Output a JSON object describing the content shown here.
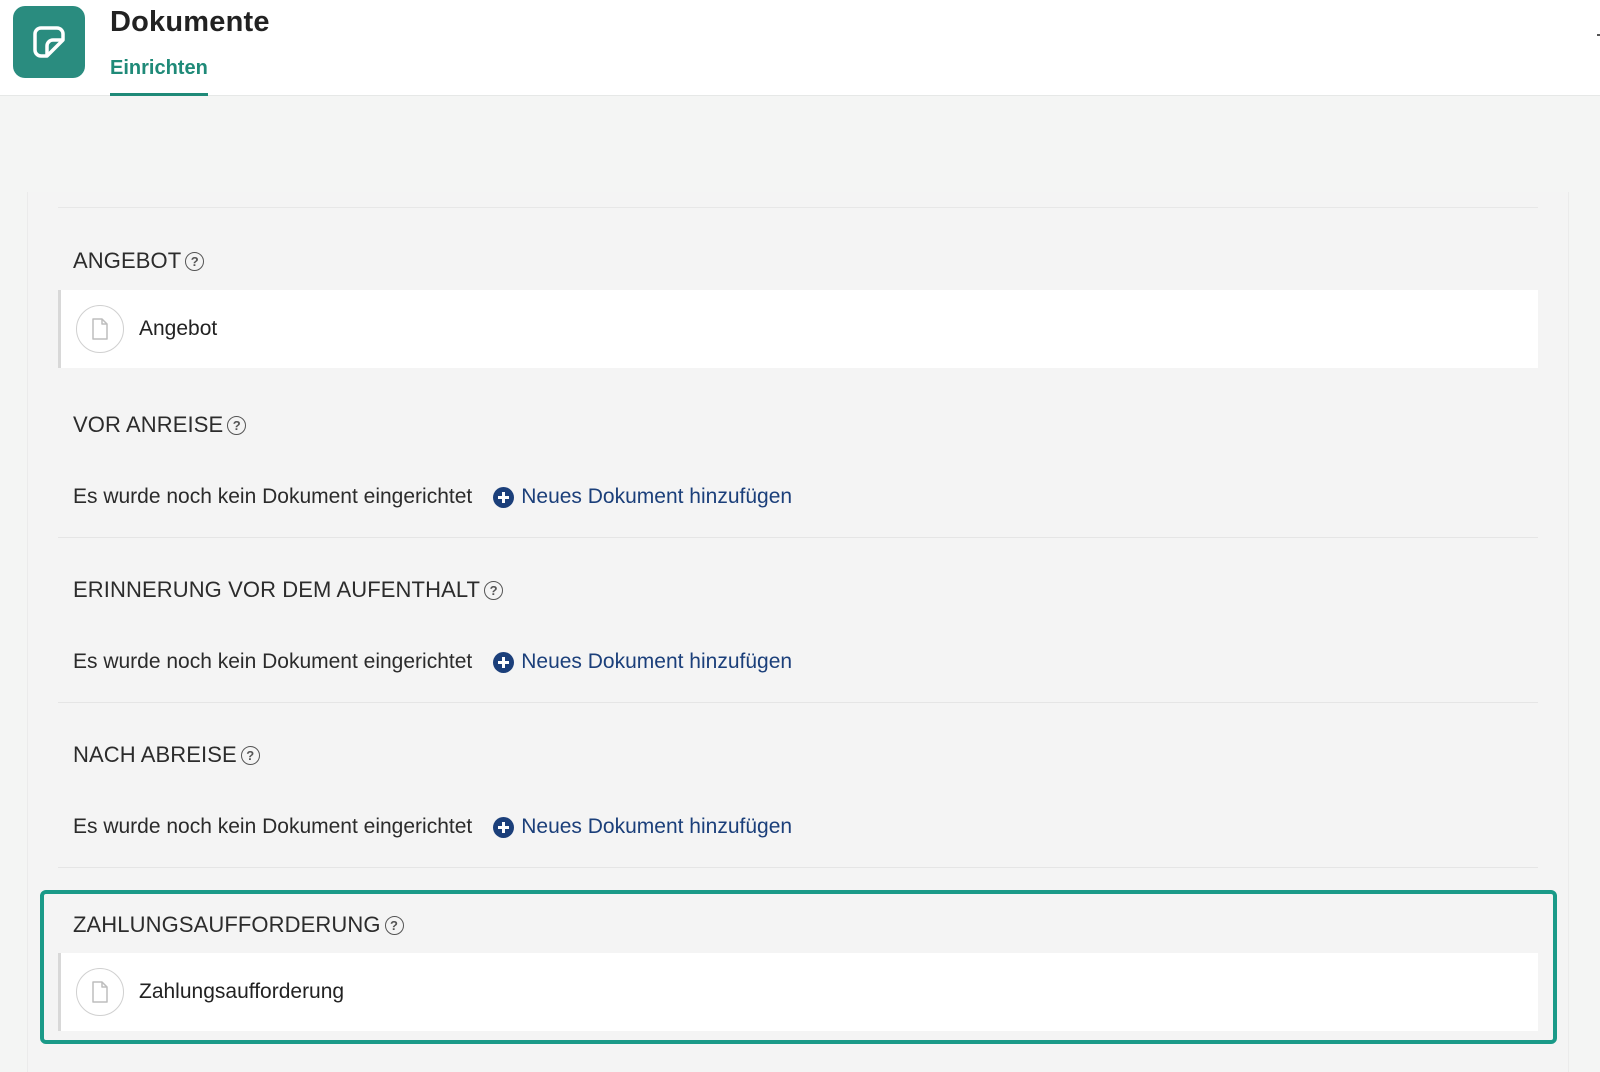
{
  "header": {
    "app_title": "Dokumente",
    "tab_label": "Einrichten",
    "accent_color": "#1f8a78",
    "app_icon": "document-icon"
  },
  "sections": [
    {
      "title": "ANGEBOT",
      "documents": [
        "Angebot"
      ]
    },
    {
      "title": "VOR ANREISE",
      "empty_text": "Es wurde noch kein Dokument eingerichtet",
      "add_label": "Neues Dokument hinzufügen"
    },
    {
      "title": "ERINNERUNG VOR DEM AUFENTHALT",
      "empty_text": "Es wurde noch kein Dokument eingerichtet",
      "add_label": "Neues Dokument hinzufügen"
    },
    {
      "title": "NACH ABREISE",
      "empty_text": "Es wurde noch kein Dokument eingerichtet",
      "add_label": "Neues Dokument hinzufügen"
    },
    {
      "title": "ZAHLUNGSAUFFORDERUNG",
      "documents": [
        "Zahlungsaufforderung"
      ],
      "highlighted": true
    }
  ],
  "help_symbol": "?",
  "link_color": "#1b3f7a",
  "highlight_color": "#1a9a88"
}
